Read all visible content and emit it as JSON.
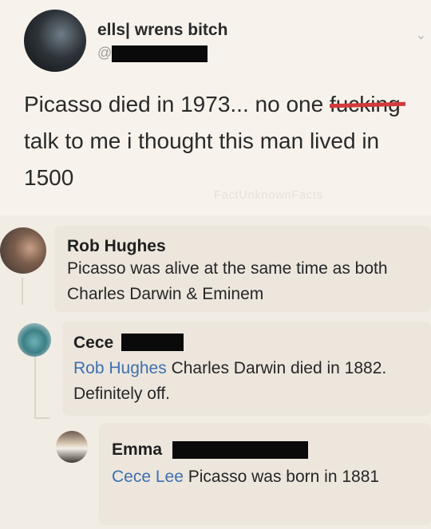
{
  "tweet": {
    "author": "ells| wrens bitch",
    "handle": "@",
    "text_before": "Picasso died in 1973... no one ",
    "struck_word": "fucking",
    "text_after": " talk to me i thought this man lived in 1500",
    "watermark": "FactUnknownFacts"
  },
  "comments": [
    {
      "name": "Rob Hughes",
      "mention": "",
      "text": "Picasso was alive at the same time as both Charles Darwin & Eminem"
    },
    {
      "name": "Cece",
      "mention": "Rob Hughes",
      "text": " Charles Darwin died in 1882. Definitely off."
    },
    {
      "name": "Emma",
      "mention": "Cece Lee",
      "text": " Picasso was born in 1881"
    }
  ],
  "colors": {
    "mention": "#3f6fae",
    "strike": "#d33a3a"
  }
}
